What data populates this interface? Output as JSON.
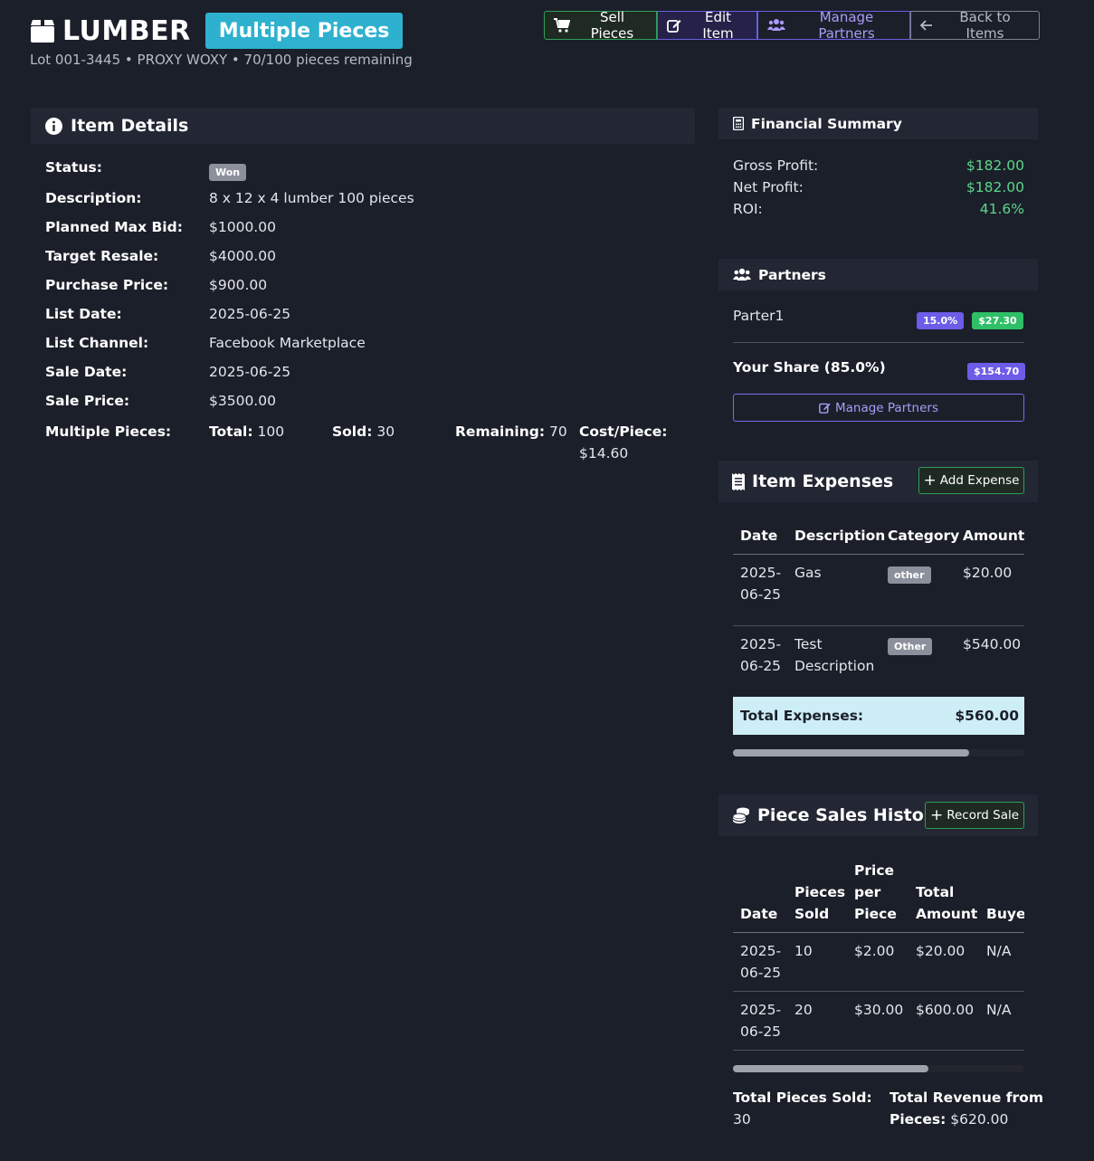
{
  "header": {
    "title": "LUMBER",
    "badge": "Multiple Pieces",
    "subtitle": "Lot 001-3445 • PROXY WOXY • 70/100 pieces remaining",
    "buttons": {
      "sell": "Sell Pieces",
      "edit": "Edit Item",
      "partners": "Manage Partners",
      "back": "Back to Items"
    }
  },
  "item_details": {
    "title": "Item Details",
    "status_label": "Status:",
    "status_value": "Won",
    "rows": [
      {
        "label": "Description:",
        "value": "8 x 12 x 4 lumber 100 pieces"
      },
      {
        "label": "Planned Max Bid:",
        "value": "$1000.00"
      },
      {
        "label": "Target Resale:",
        "value": "$4000.00"
      },
      {
        "label": "Purchase Price:",
        "value": "$900.00"
      },
      {
        "label": "List Date:",
        "value": "2025-06-25"
      },
      {
        "label": "List Channel:",
        "value": "Facebook Marketplace"
      },
      {
        "label": "Sale Date:",
        "value": "2025-06-25"
      },
      {
        "label": "Sale Price:",
        "value": "$3500.00"
      }
    ],
    "pieces": {
      "label": "Multiple Pieces:",
      "total_label": "Total:",
      "total": "100",
      "sold_label": "Sold:",
      "sold": "30",
      "remaining_label": "Remaining:",
      "remaining": "70",
      "cost_label": "Cost/Piece:",
      "cost": "$14.60"
    }
  },
  "financial": {
    "title": "Financial Summary",
    "rows": [
      {
        "label": "Gross Profit:",
        "value": "$182.00"
      },
      {
        "label": "Net Profit:",
        "value": "$182.00"
      },
      {
        "label": "ROI:",
        "value": "41.6%"
      }
    ]
  },
  "partners": {
    "title": "Partners",
    "list": [
      {
        "name": "Parter1",
        "percent": "15.0%",
        "amount": "$27.30"
      }
    ],
    "your_share_label": "Your Share (85.0%)",
    "your_share_amount": "$154.70",
    "manage_button": "Manage Partners"
  },
  "expenses": {
    "title": "Item Expenses",
    "add_button": "Add Expense",
    "columns": [
      "Date",
      "Description",
      "Category",
      "Amount"
    ],
    "rows": [
      {
        "date1": "2025-",
        "date2": "06-25",
        "desc1": "Gas",
        "desc2": "",
        "category": "other",
        "amount": "$20.00"
      },
      {
        "date1": "2025-",
        "date2": "06-25",
        "desc1": "Test",
        "desc2": "Description",
        "category": "Other",
        "amount": "$540.00"
      }
    ],
    "total_label": "Total Expenses:",
    "total_value": "$560.00",
    "scroll_fraction": 0.81
  },
  "sales": {
    "title": "Piece Sales History",
    "record_button": "Record Sale",
    "columns": {
      "date": "Date",
      "pieces1": "Pieces",
      "pieces2": "Sold",
      "price1": "Price",
      "price2": "per",
      "price3": "Piece",
      "total1": "Total",
      "total2": "Amount",
      "buyer": "Buyer"
    },
    "rows": [
      {
        "date1": "2025-",
        "date2": "06-25",
        "pieces": "10",
        "price": "$2.00",
        "total": "$20.00",
        "buyer": "N/A"
      },
      {
        "date1": "2025-",
        "date2": "06-25",
        "pieces": "20",
        "price": "$30.00",
        "total": "$600.00",
        "buyer": "N/A"
      }
    ],
    "summary": {
      "pieces_label": "Total Pieces Sold:",
      "pieces_value": "30",
      "revenue_label1": "Total Revenue from",
      "revenue_label2": "Pieces:",
      "revenue_value": "$620.00"
    },
    "scroll_fraction": 0.67
  },
  "colors": {
    "background": "#1b1f2a",
    "accent_cyan": "#2eb1cf",
    "success": "#5cd68a",
    "purple": "#6d5ce8"
  }
}
